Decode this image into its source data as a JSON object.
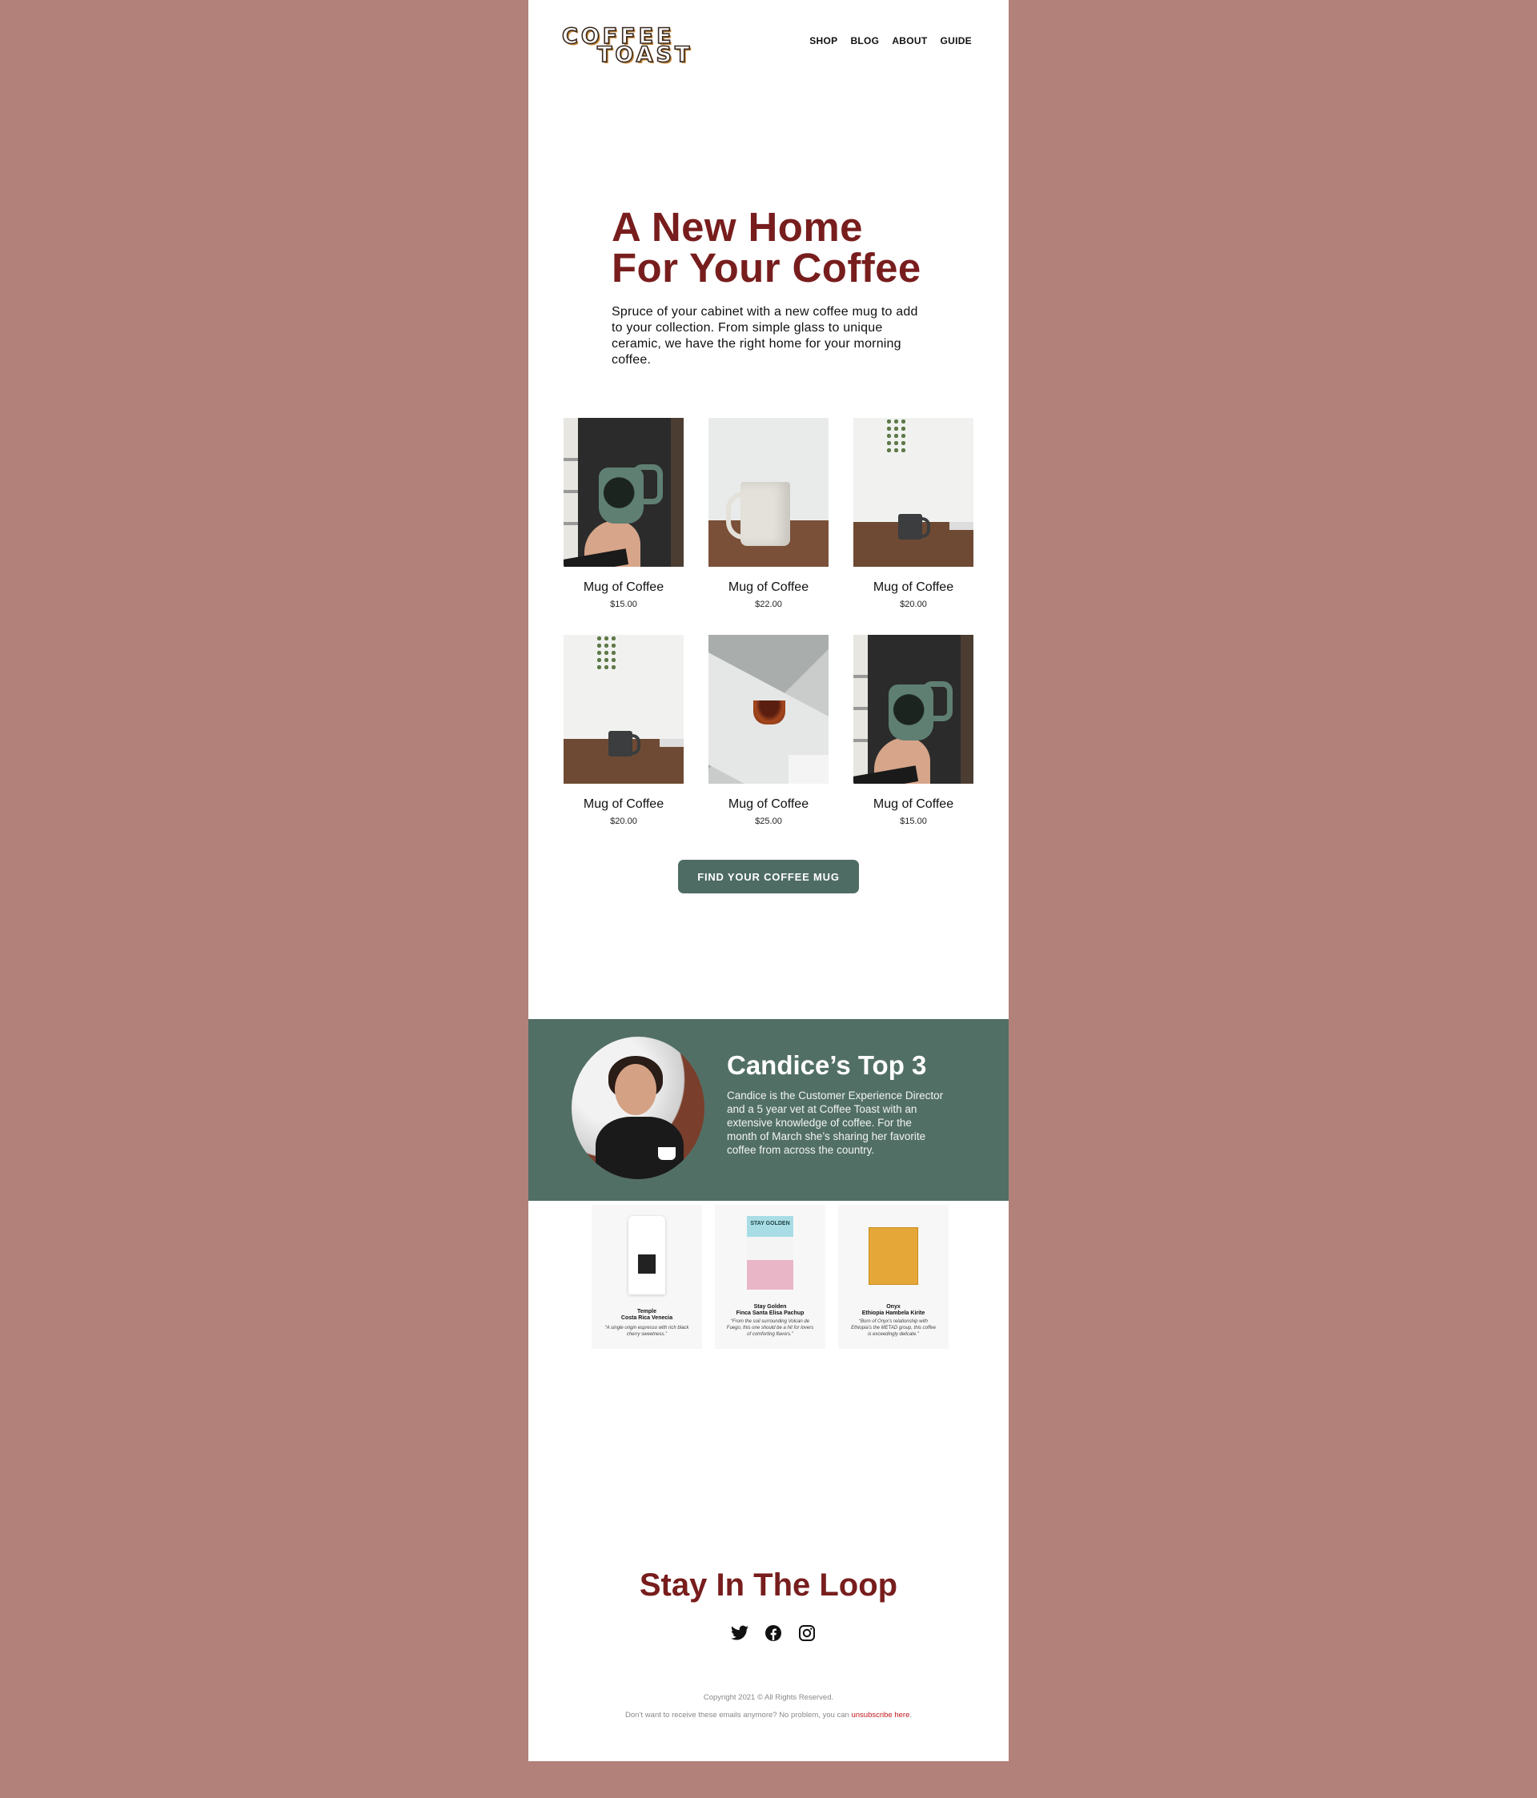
{
  "header": {
    "logo_line1": "COFFEE",
    "logo_line2": "TOAST",
    "nav": [
      "SHOP",
      "BLOG",
      "ABOUT",
      "GUIDE"
    ]
  },
  "hero": {
    "title_line1": "A New Home",
    "title_line2": "For Your Coffee",
    "body": "Spruce of your cabinet with a new coffee mug to add to your collection. From simple glass to unique ceramic, we have the right home for your morning coffee."
  },
  "products": [
    {
      "name": "Mug of Coffee",
      "price": "$15.00"
    },
    {
      "name": "Mug of Coffee",
      "price": "$22.00"
    },
    {
      "name": "Mug of Coffee",
      "price": "$20.00"
    },
    {
      "name": "Mug of Coffee",
      "price": "$20.00"
    },
    {
      "name": "Mug of Coffee",
      "price": "$25.00"
    },
    {
      "name": "Mug of Coffee",
      "price": "$15.00"
    }
  ],
  "cta_label": "FIND YOUR COFFEE MUG",
  "feature": {
    "title": "Candice’s Top 3",
    "body": "Candice is the Customer Experience Director and a 5 year vet at Coffee Toast with an extensive knowledge of coffee. For the month of March she’s sharing her favorite coffee from across the country."
  },
  "top3": [
    {
      "brand": "Temple",
      "name": "Costa Rica Venecia",
      "quote": "“A single origin espresso with rich black cherry sweetness.”"
    },
    {
      "brand": "Stay Golden",
      "name": "Finca Santa Elisa Pachup",
      "quote": "“From the soil surrounding Volcan de Fuego, this one should be a hit for lovers of comforting flavors.”",
      "bag_text": "STAY GOLDEN"
    },
    {
      "brand": "Onyx",
      "name": "Ethiopia Hambela Kirite",
      "quote": "“Born of Onyx’s relationship with Ethiopia’s the METAD group, this coffee is exceedingly delicate.”"
    }
  ],
  "footer": {
    "title": "Stay In The Loop",
    "copyright": "Copyright 2021 © All Rights Reserved.",
    "unsub_text": "Don’t want to receive these emails anymore? No problem, you can ",
    "unsub_link": "unsubscribe here",
    "unsub_end": "."
  },
  "colors": {
    "background": "#b2817a",
    "accent": "#781d1d",
    "green": "#526f66",
    "button": "#4f6c64",
    "link": "#c4161c"
  },
  "icons": [
    "twitter-icon",
    "facebook-icon",
    "instagram-icon"
  ]
}
